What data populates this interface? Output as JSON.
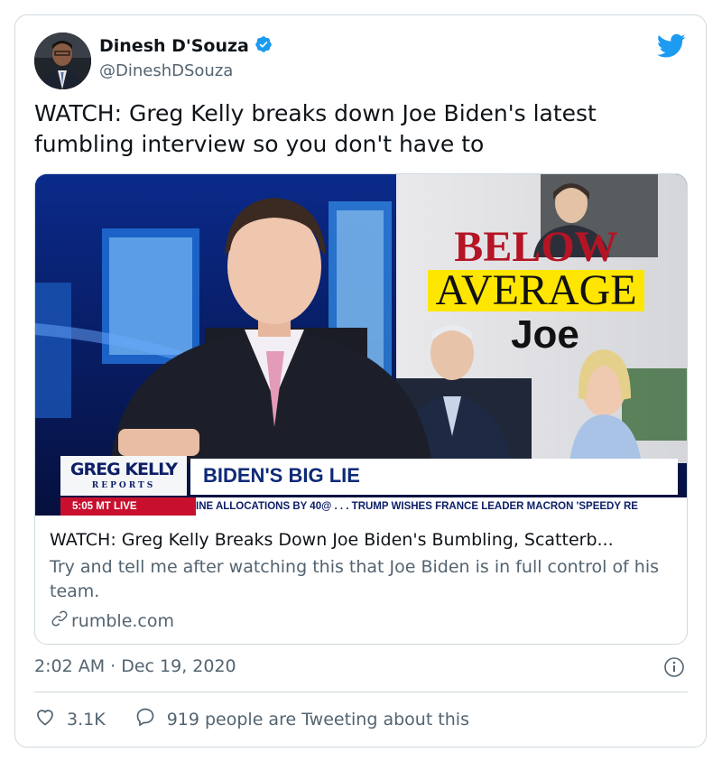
{
  "author": {
    "name": "Dinesh D'Souza",
    "handle": "@DineshDSouza",
    "verified": true
  },
  "tweet": {
    "text": "WATCH: Greg Kelly breaks down Joe Biden's latest fumbling interview so you don't have to",
    "timestamp": "2:02 AM · Dec 19, 2020"
  },
  "link_card": {
    "title": "WATCH: Greg Kelly Breaks Down Joe Biden's Bumbling, Scatterb...",
    "description": "Try and tell me after watching this that Joe Biden is in full control of his team.",
    "domain": "rumble.com"
  },
  "media_overlay": {
    "logo_line1": "GREG KELLY",
    "logo_line2": "REPORTS",
    "headline": "BIDEN'S BIG LIE",
    "time_live": "5:05 MT  LIVE",
    "crawl": "INE ALLOCATIONS BY 40@ . . .     TRUMP WISHES FRANCE LEADER MACRON 'SPEEDY RE",
    "graphic_line1": "BELOW",
    "graphic_line2": "AVERAGE",
    "graphic_line3": "Joe"
  },
  "actions": {
    "likes": "3.1K",
    "conversation": "919 people are Tweeting about this"
  },
  "icons": {
    "verified": "verified-badge-icon",
    "brand": "twitter-bird-icon",
    "link": "link-icon",
    "info": "info-icon",
    "like": "heart-icon",
    "reply": "speech-bubble-icon"
  },
  "colors": {
    "twitter_blue": "#1d9bf0",
    "text_primary": "#0f1419",
    "text_secondary": "#536471",
    "border": "#cfd9de",
    "fox_red": "#c8102e",
    "fox_navy": "#0d1f66"
  }
}
